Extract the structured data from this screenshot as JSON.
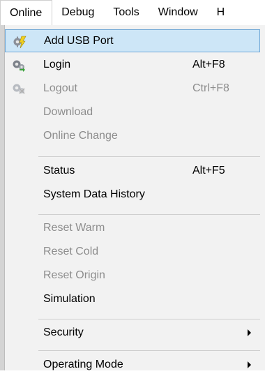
{
  "menubar": {
    "items": [
      "Online",
      "Debug",
      "Tools",
      "Window",
      "H"
    ]
  },
  "menu": {
    "add_usb_port": "Add USB Port",
    "login": "Login",
    "login_shortcut": "Alt+F8",
    "logout": "Logout",
    "logout_shortcut": "Ctrl+F8",
    "download": "Download",
    "online_change": "Online Change",
    "status": "Status",
    "status_shortcut": "Alt+F5",
    "system_data_history": "System Data History",
    "reset_warm": "Reset Warm",
    "reset_cold": "Reset Cold",
    "reset_origin": "Reset Origin",
    "simulation": "Simulation",
    "security": "Security",
    "operating_mode": "Operating Mode"
  },
  "icons": {
    "add_usb_port": "usb-plug-gear-icon",
    "login": "gear-login-icon",
    "logout": "gear-logout-icon",
    "submenu": "submenu-arrow-icon"
  },
  "colors": {
    "highlight_bg": "#cde6f7",
    "highlight_border": "#6fa7d6",
    "disabled_text": "#8d8d8d",
    "menu_bg": "#f2f2f2"
  }
}
